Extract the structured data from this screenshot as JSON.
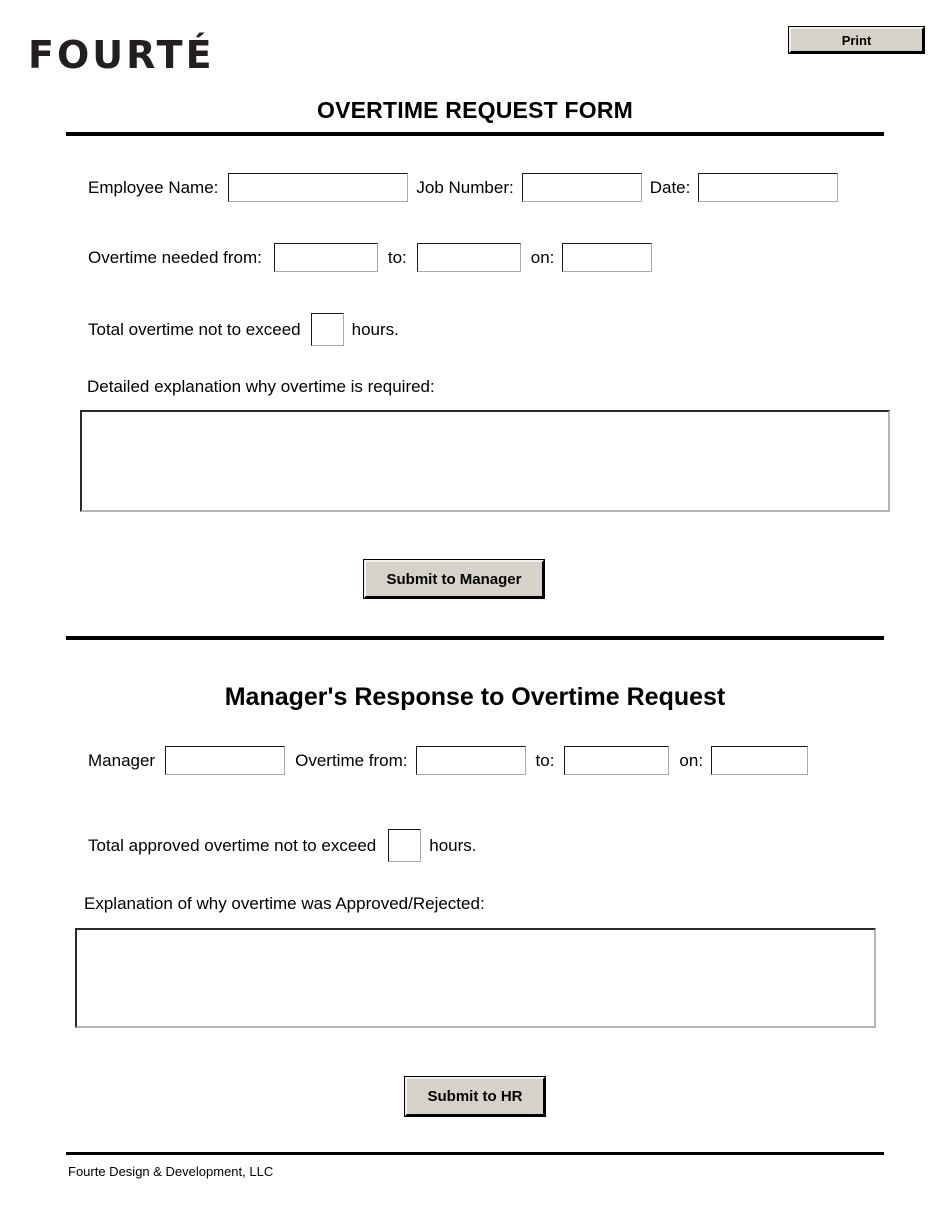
{
  "header": {
    "logo_text": "FOURTÉ",
    "print_label": "Print",
    "form_title": "OVERTIME REQUEST FORM"
  },
  "employee_section": {
    "row1": {
      "employee_name_label": "Employee Name:",
      "employee_name_value": "",
      "job_number_label": "Job Number:",
      "job_number_value": "",
      "date_label": "Date:",
      "date_value": ""
    },
    "row2": {
      "overtime_from_label": "Overtime needed from:",
      "overtime_from_value": "",
      "to_label": "to:",
      "overtime_to_value": "",
      "on_label": "on:",
      "overtime_on_value": ""
    },
    "row3": {
      "total_prefix_label": "Total overtime not to exceed",
      "total_hours_value": "",
      "hours_suffix_label": "hours."
    },
    "explanation_label": "Detailed explanation why overtime is required:",
    "explanation_value": "",
    "submit_label": "Submit to Manager"
  },
  "manager_section": {
    "title": "Manager's Response to Overtime Request",
    "row1": {
      "manager_label": "Manager",
      "manager_value": "",
      "overtime_from_label": "Overtime from:",
      "overtime_from_value": "",
      "to_label": "to:",
      "overtime_to_value": "",
      "on_label": "on:",
      "overtime_on_value": ""
    },
    "row2": {
      "total_prefix_label": "Total approved overtime not to exceed",
      "total_hours_value": "",
      "hours_suffix_label": "hours."
    },
    "explanation_label": "Explanation of why overtime was Approved/Rejected:",
    "explanation_value": "",
    "submit_label": "Submit to HR"
  },
  "footer": {
    "company_text": "Fourte Design & Development, LLC"
  },
  "colors": {
    "button_face": "#d6d2c9",
    "rule": "#000000",
    "logo": "#231f20",
    "field_border_dark": "#1a1a1a",
    "field_border_light": "#a9a9a9"
  }
}
